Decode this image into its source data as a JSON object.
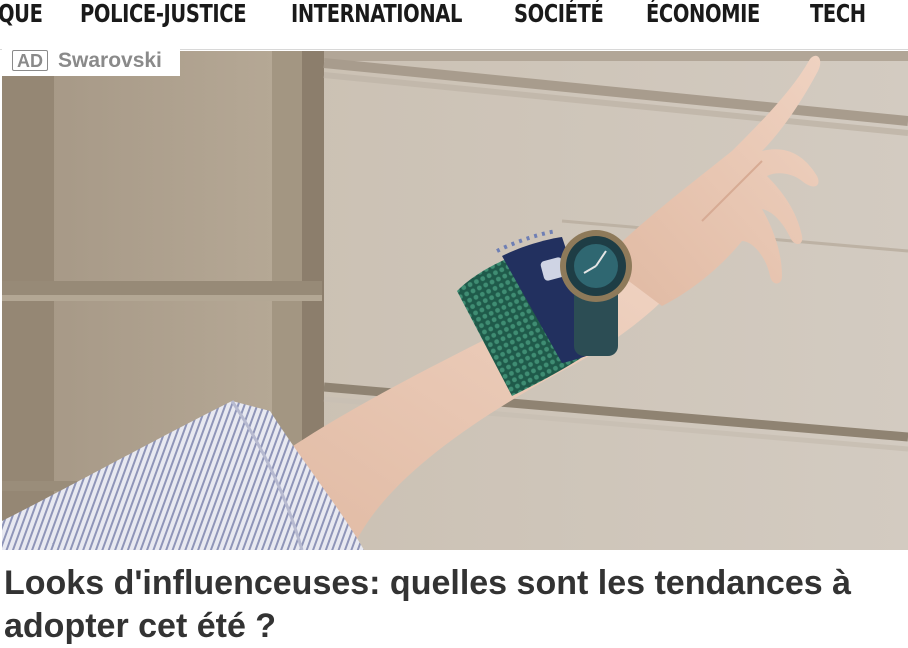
{
  "nav": {
    "items": [
      {
        "label": "QUE"
      },
      {
        "label": "POLICE-JUSTICE"
      },
      {
        "label": "INTERNATIONAL"
      },
      {
        "label": "SOCIÉTÉ"
      },
      {
        "label": "ÉCONOMIE"
      },
      {
        "label": "TECH"
      }
    ]
  },
  "ad": {
    "label": "AD",
    "sponsor": "Swarovski",
    "image_icon": "photo-arm-with-watch-and-bracelets",
    "headline": "Looks d'influenceuses: quelles sont les tendances à adopter cet été ?"
  },
  "colors": {
    "headline": "#333333",
    "ad_text": "#8a8a8a",
    "nav_text": "#1a1a1a"
  }
}
